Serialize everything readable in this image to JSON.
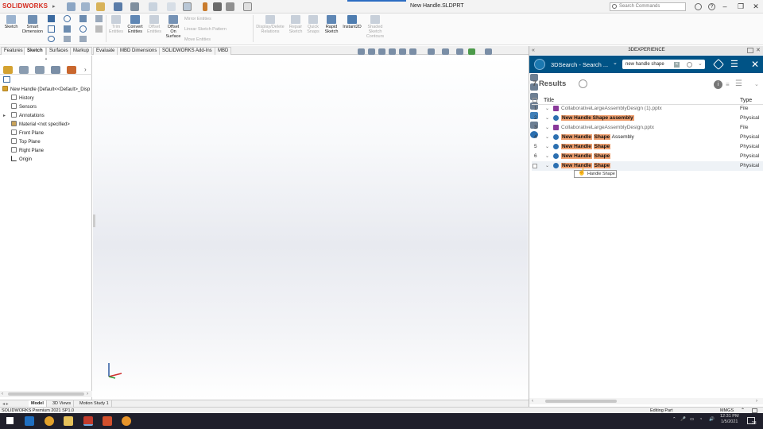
{
  "app": {
    "logo": "SOLIDWORKS",
    "doc_title": "New Handle.SLDPRT",
    "search_commands_placeholder": "Search Commands"
  },
  "ribbon": {
    "sketch": "Sketch",
    "smart_dimension": "Smart Dimension",
    "trim_entities": "Trim Entities",
    "convert_entities": "Convert Entities",
    "offset_entities": "Offset Entities",
    "offset_on_surface": "Offset On Surface",
    "mirror_entities": "Mirror Entities",
    "linear_sketch_pattern": "Linear Sketch Pattern",
    "move_entities": "Move Entities",
    "display_delete_relations": "Display/Delete Relations",
    "repair_sketch": "Repair Sketch",
    "quick_snaps": "Quick Snaps",
    "rapid_sketch": "Rapid Sketch",
    "instant2d": "Instant2D",
    "shaded_sketch_contours": "Shaded Sketch Contours"
  },
  "tabs": [
    "Features",
    "Sketch",
    "Surfaces",
    "Markup",
    "Evaluate",
    "MBD Dimensions",
    "SOLIDWORKS Add-Ins",
    "MBD"
  ],
  "tree": {
    "root": "New Handle  (Default<<Default>_Disp",
    "items": [
      "History",
      "Sensors",
      "Annotations",
      "Material <not specified>",
      "Front Plane",
      "Top Plane",
      "Right Plane",
      "Origin"
    ]
  },
  "bottom_tabs": [
    "Model",
    "3D Views",
    "Motion Study 1"
  ],
  "status": {
    "left": "SOLIDWORKS Premium 2021 SP1.0",
    "mode": "Editing Part",
    "units": "MMGS"
  },
  "panel": {
    "header": "3DEXPERIENCE",
    "search_title": "3DSearch - Search ...",
    "search_value": "new handle shape",
    "results_count": "7",
    "results_label": "Results",
    "col_title": "Title",
    "col_type": "Type",
    "rows": [
      {
        "num": "1",
        "pre": "",
        "hl1": "",
        "hl2": "",
        "post": "CollaborativeLargeAssemblyDesign (1).pptx",
        "type": "File"
      },
      {
        "num": "2",
        "pre": "",
        "hl1": "New Handle Shape assembly",
        "hl2": "",
        "post": "",
        "type": "Physical"
      },
      {
        "num": "3",
        "pre": "",
        "hl1": "",
        "hl2": "",
        "post": "CollaborativeLargeAssemblyDesign.pptx",
        "type": "File"
      },
      {
        "num": "4",
        "pre": "",
        "hl1": "New Handle",
        "hl2": "Shape",
        "post": " Assembly",
        "type": "Physical"
      },
      {
        "num": "5",
        "pre": "",
        "hl1": "New Handle",
        "hl2": "Shape",
        "post": "",
        "type": "Physical"
      },
      {
        "num": "6",
        "pre": "",
        "hl1": "New Handle",
        "hl2": "Shape",
        "post": "",
        "type": "Physical"
      },
      {
        "num": "",
        "pre": "",
        "hl1": "New Handle",
        "hl2": "Shape",
        "post": "",
        "type": "Physical"
      }
    ],
    "tooltip": "Handle Shape"
  },
  "taskbar": {
    "time": "12:31 PM",
    "date": "1/5/2021",
    "notif": "28"
  },
  "colors": {
    "panel_blue": "#005386",
    "highlight": "#f0a070",
    "sw_red": "#d52b1e"
  }
}
